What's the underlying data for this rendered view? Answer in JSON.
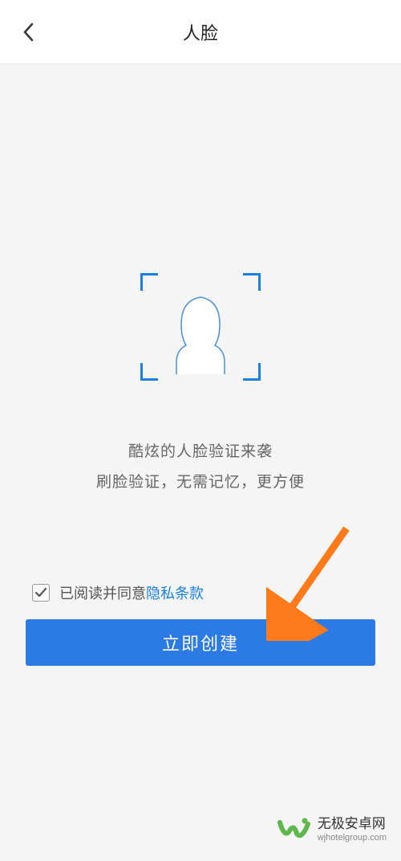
{
  "header": {
    "title": "人脸"
  },
  "description": {
    "line1": "酷炫的人脸验证来袭",
    "line2": "刷脸验证，无需记忆，更方便"
  },
  "agreement": {
    "prefix": "已阅读并同意",
    "link": "隐私条款",
    "checked": true
  },
  "button": {
    "label": "立即创建"
  },
  "watermark": {
    "name": "无极安卓网",
    "url": "wjhotelgroup.com"
  }
}
